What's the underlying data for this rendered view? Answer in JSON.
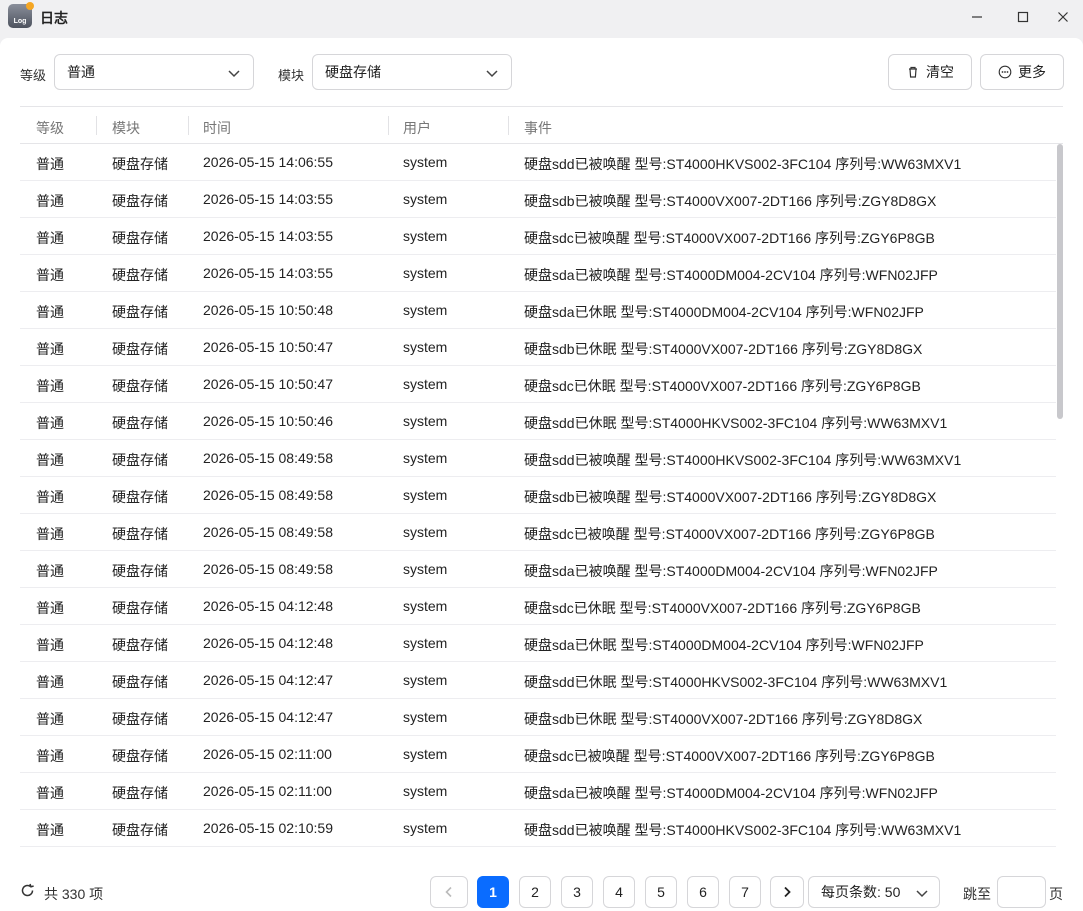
{
  "window": {
    "icon_text": "Log",
    "title": "日志"
  },
  "filters": {
    "level_label": "等级",
    "level_value": "普通",
    "module_label": "模块",
    "module_value": "硬盘存储",
    "clear_label": "清空",
    "more_label": "更多"
  },
  "table": {
    "columns": [
      "等级",
      "模块",
      "时间",
      "用户",
      "事件"
    ],
    "rows": [
      [
        "普通",
        "硬盘存储",
        "2026-05-15 14:06:55",
        "system",
        "硬盘sdd已被唤醒 型号:ST4000HKVS002-3FC104 序列号:WW63MXV1"
      ],
      [
        "普通",
        "硬盘存储",
        "2026-05-15 14:03:55",
        "system",
        "硬盘sdb已被唤醒 型号:ST4000VX007-2DT166 序列号:ZGY8D8GX"
      ],
      [
        "普通",
        "硬盘存储",
        "2026-05-15 14:03:55",
        "system",
        "硬盘sdc已被唤醒 型号:ST4000VX007-2DT166 序列号:ZGY6P8GB"
      ],
      [
        "普通",
        "硬盘存储",
        "2026-05-15 14:03:55",
        "system",
        "硬盘sda已被唤醒 型号:ST4000DM004-2CV104 序列号:WFN02JFP"
      ],
      [
        "普通",
        "硬盘存储",
        "2026-05-15 10:50:48",
        "system",
        "硬盘sda已休眠 型号:ST4000DM004-2CV104 序列号:WFN02JFP"
      ],
      [
        "普通",
        "硬盘存储",
        "2026-05-15 10:50:47",
        "system",
        "硬盘sdb已休眠 型号:ST4000VX007-2DT166 序列号:ZGY8D8GX"
      ],
      [
        "普通",
        "硬盘存储",
        "2026-05-15 10:50:47",
        "system",
        "硬盘sdc已休眠 型号:ST4000VX007-2DT166 序列号:ZGY6P8GB"
      ],
      [
        "普通",
        "硬盘存储",
        "2026-05-15 10:50:46",
        "system",
        "硬盘sdd已休眠 型号:ST4000HKVS002-3FC104 序列号:WW63MXV1"
      ],
      [
        "普通",
        "硬盘存储",
        "2026-05-15 08:49:58",
        "system",
        "硬盘sdd已被唤醒 型号:ST4000HKVS002-3FC104 序列号:WW63MXV1"
      ],
      [
        "普通",
        "硬盘存储",
        "2026-05-15 08:49:58",
        "system",
        "硬盘sdb已被唤醒 型号:ST4000VX007-2DT166 序列号:ZGY8D8GX"
      ],
      [
        "普通",
        "硬盘存储",
        "2026-05-15 08:49:58",
        "system",
        "硬盘sdc已被唤醒 型号:ST4000VX007-2DT166 序列号:ZGY6P8GB"
      ],
      [
        "普通",
        "硬盘存储",
        "2026-05-15 08:49:58",
        "system",
        "硬盘sda已被唤醒 型号:ST4000DM004-2CV104 序列号:WFN02JFP"
      ],
      [
        "普通",
        "硬盘存储",
        "2026-05-15 04:12:48",
        "system",
        "硬盘sdc已休眠 型号:ST4000VX007-2DT166 序列号:ZGY6P8GB"
      ],
      [
        "普通",
        "硬盘存储",
        "2026-05-15 04:12:48",
        "system",
        "硬盘sda已休眠 型号:ST4000DM004-2CV104 序列号:WFN02JFP"
      ],
      [
        "普通",
        "硬盘存储",
        "2026-05-15 04:12:47",
        "system",
        "硬盘sdd已休眠 型号:ST4000HKVS002-3FC104 序列号:WW63MXV1"
      ],
      [
        "普通",
        "硬盘存储",
        "2026-05-15 04:12:47",
        "system",
        "硬盘sdb已休眠 型号:ST4000VX007-2DT166 序列号:ZGY8D8GX"
      ],
      [
        "普通",
        "硬盘存储",
        "2026-05-15 02:11:00",
        "system",
        "硬盘sdc已被唤醒 型号:ST4000VX007-2DT166 序列号:ZGY6P8GB"
      ],
      [
        "普通",
        "硬盘存储",
        "2026-05-15 02:11:00",
        "system",
        "硬盘sda已被唤醒 型号:ST4000DM004-2CV104 序列号:WFN02JFP"
      ],
      [
        "普通",
        "硬盘存储",
        "2026-05-15 02:10:59",
        "system",
        "硬盘sdd已被唤醒 型号:ST4000HKVS002-3FC104 序列号:WW63MXV1"
      ]
    ]
  },
  "footer": {
    "total": "共 330 项",
    "pages": [
      "1",
      "2",
      "3",
      "4",
      "5",
      "6",
      "7"
    ],
    "current_page": "1",
    "per_page": "每页条数: 50",
    "jump_label": "跳至",
    "jump_value": "",
    "page_unit": "页"
  },
  "colors": {
    "accent": "#0a6cff",
    "border": "#d6d6d9",
    "header_text": "#777777"
  },
  "icons": [
    "app-log-icon",
    "minimize-icon",
    "maximize-icon",
    "close-icon",
    "chevron-down-icon",
    "trash-icon",
    "more-icon",
    "refresh-icon",
    "chevron-left-icon",
    "chevron-right-icon"
  ]
}
